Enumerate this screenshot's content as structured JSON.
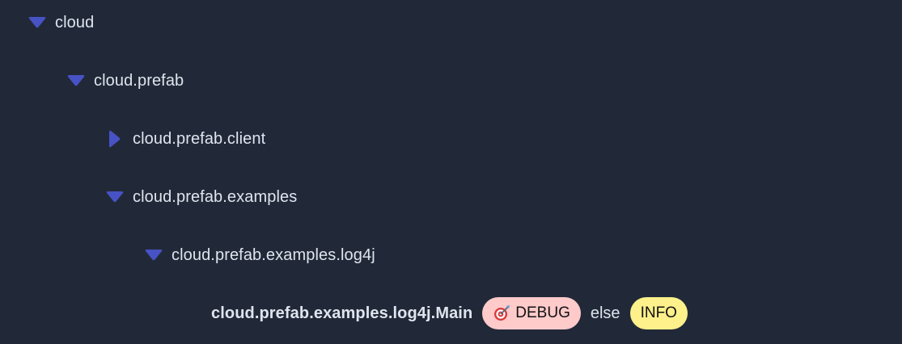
{
  "tree": [
    {
      "label": "cloud",
      "state": "expanded"
    },
    {
      "label": "cloud.prefab",
      "state": "expanded"
    },
    {
      "label": "cloud.prefab.client",
      "state": "collapsed"
    },
    {
      "label": "cloud.prefab.examples",
      "state": "expanded"
    },
    {
      "label": "cloud.prefab.examples.log4j",
      "state": "expanded"
    },
    {
      "label": "cloud.prefab.examples.log4j.Main",
      "rule": {
        "target_level": "DEBUG",
        "target_icon": "target-icon",
        "else_text": "else",
        "default_level": "INFO"
      }
    }
  ],
  "colors": {
    "background": "#212938",
    "toggle": "#4752c4",
    "text": "#dfe4ee",
    "debug_badge": "#fecaca",
    "info_badge": "#fef08a"
  }
}
